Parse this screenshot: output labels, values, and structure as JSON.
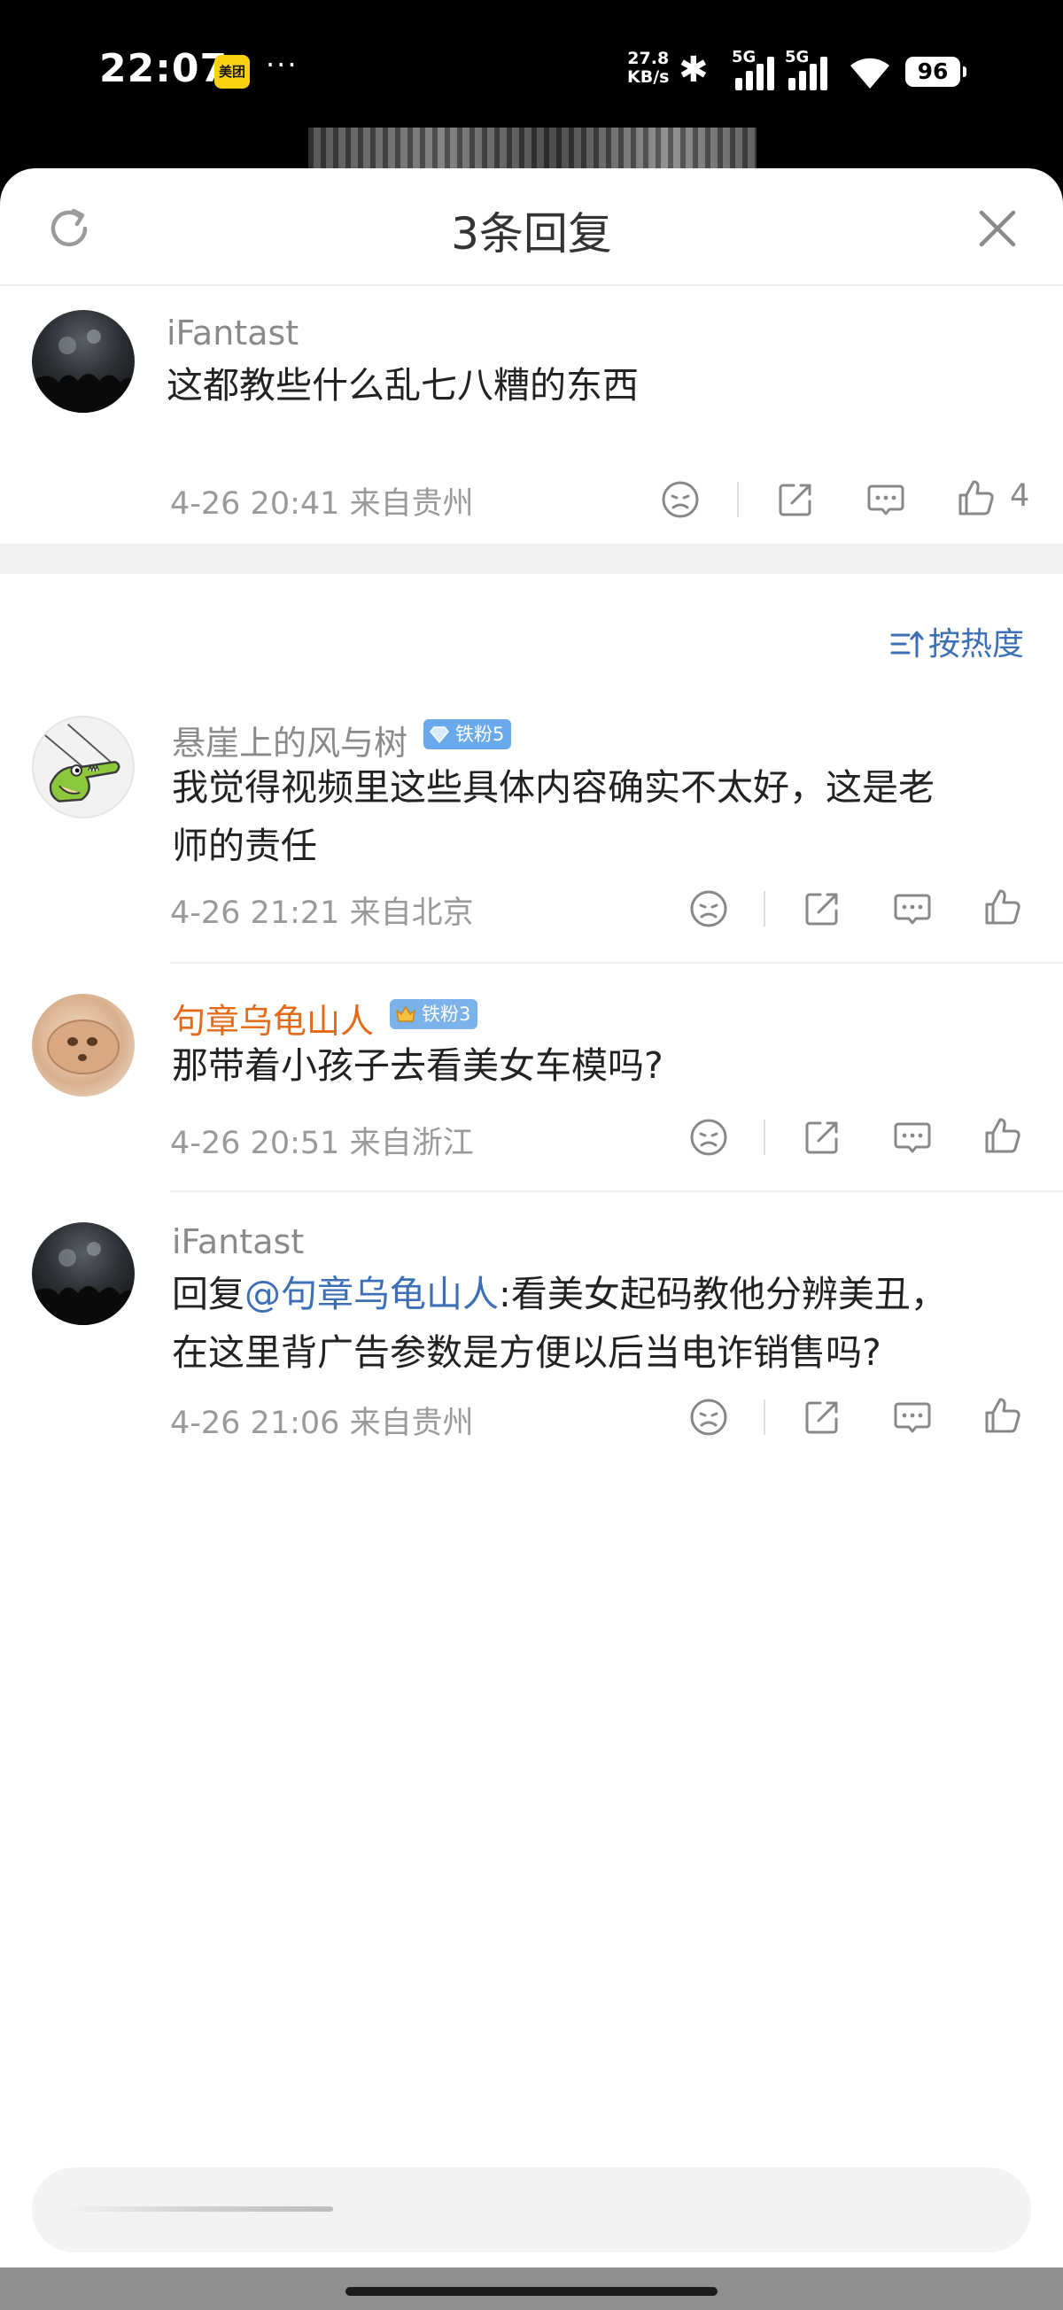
{
  "status_bar": {
    "time": "22:07",
    "app_badge": "美团",
    "dots": "···",
    "net_speed_value": "27.8",
    "net_speed_unit": "KB/s",
    "network_1": "5G",
    "network_2": "5G",
    "battery": "96"
  },
  "header": {
    "title": "3条回复"
  },
  "parent_comment": {
    "username": "iFantast",
    "content": "这都教些什么乱七八糟的东西",
    "time": "4-26 20:41",
    "location": "来自贵州",
    "like_count": "4"
  },
  "sort": {
    "label": "按热度"
  },
  "replies": [
    {
      "username": "悬崖上的风与树",
      "badge": "铁粉5",
      "content_line1": "我觉得视频里这些具体内容确实不太好，这是老",
      "content_line2": "师的责任",
      "time": "4-26 21:21",
      "location": "来自北京"
    },
    {
      "username": "句章乌龟山人",
      "badge": "铁粉3",
      "content": "那带着小孩子去看美女车模吗?",
      "time": "4-26 20:51",
      "location": "来自浙江"
    },
    {
      "username": "iFantast",
      "reply_prefix": "回复",
      "mention": "@句章乌龟山人",
      "content_rest": ":看美女起码教他分辨美丑，",
      "content_line2": "在这里背广告参数是方便以后当电诈销售吗?",
      "time": "4-26 21:06",
      "location": "来自贵州"
    }
  ],
  "colors": {
    "accent_blue": "#3d6fb6",
    "username_orange": "#e36a18",
    "badge_blue": "#6aa9ec"
  }
}
